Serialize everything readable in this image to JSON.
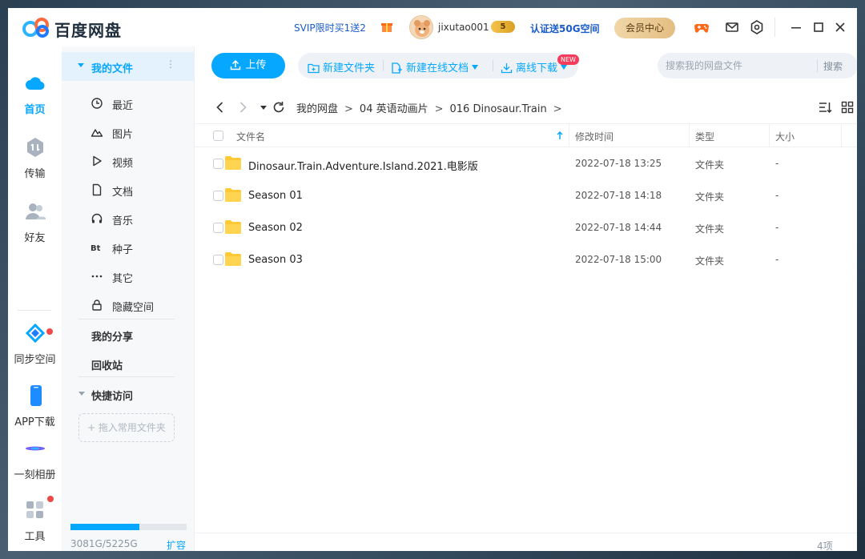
{
  "app": {
    "title": "百度网盘"
  },
  "header": {
    "promo": "SVIP限时买1送2",
    "username": "jixutao001",
    "level": "5",
    "certify": "认证送50G空间",
    "vip_center": "会员中心"
  },
  "leftnav": {
    "items": [
      {
        "label": "首页",
        "icon": "cloud-icon"
      },
      {
        "label": "传输",
        "icon": "transfer-icon"
      },
      {
        "label": "好友",
        "icon": "friends-icon"
      },
      {
        "label": "同步空间",
        "icon": "sync-icon"
      },
      {
        "label": "APP下载",
        "icon": "phone-icon"
      },
      {
        "label": "一刻相册",
        "icon": "album-icon"
      },
      {
        "label": "工具",
        "icon": "tools-icon"
      }
    ]
  },
  "sidebar": {
    "my_files": "我的文件",
    "more": "⋮",
    "items": [
      {
        "label": "最近",
        "icon": "clock-icon"
      },
      {
        "label": "图片",
        "icon": "image-icon"
      },
      {
        "label": "视频",
        "icon": "video-icon"
      },
      {
        "label": "文档",
        "icon": "document-icon"
      },
      {
        "label": "音乐",
        "icon": "music-icon"
      },
      {
        "label": "种子",
        "icon": "torrent-icon"
      },
      {
        "label": "其它",
        "icon": "more-icon"
      },
      {
        "label": "隐藏空间",
        "icon": "lock-icon"
      }
    ],
    "my_share": "我的分享",
    "recycle": "回收站",
    "quick_access": "快捷访问",
    "drop_hint": "+ 拖入常用文件夹",
    "quota_text": "3081G/5225G",
    "quota_used": 3081,
    "quota_total": 5225,
    "expand": "扩容"
  },
  "toolbar": {
    "upload": "上传",
    "new_folder": "新建文件夹",
    "new_doc": "新建在线文档",
    "new_badge": "NEW",
    "offline_download": "离线下载",
    "search_placeholder": "搜索我的网盘文件",
    "search_button": "搜索"
  },
  "breadcrumb": [
    "我的网盘",
    "04 英语动画片",
    "016 Dinosaur.Train"
  ],
  "breadcrumb_sep": ">",
  "table": {
    "columns": {
      "name": "文件名",
      "modified": "修改时间",
      "type": "类型",
      "size": "大小"
    },
    "rows": [
      {
        "name": "Dinosaur.Train.Adventure.Island.2021.电影版",
        "modified": "2022-07-18 13:25",
        "type": "文件夹",
        "size": "-"
      },
      {
        "name": "Season 01",
        "modified": "2022-07-18 14:18",
        "type": "文件夹",
        "size": "-"
      },
      {
        "name": "Season 02",
        "modified": "2022-07-18 14:44",
        "type": "文件夹",
        "size": "-"
      },
      {
        "name": "Season 03",
        "modified": "2022-07-18 15:00",
        "type": "文件夹",
        "size": "-"
      }
    ]
  },
  "footer": {
    "count": "4项"
  },
  "colors": {
    "accent": "#06a7ff",
    "folder": "#ffc933",
    "badge": "#f33c5b",
    "link": "#1a5bc9"
  }
}
